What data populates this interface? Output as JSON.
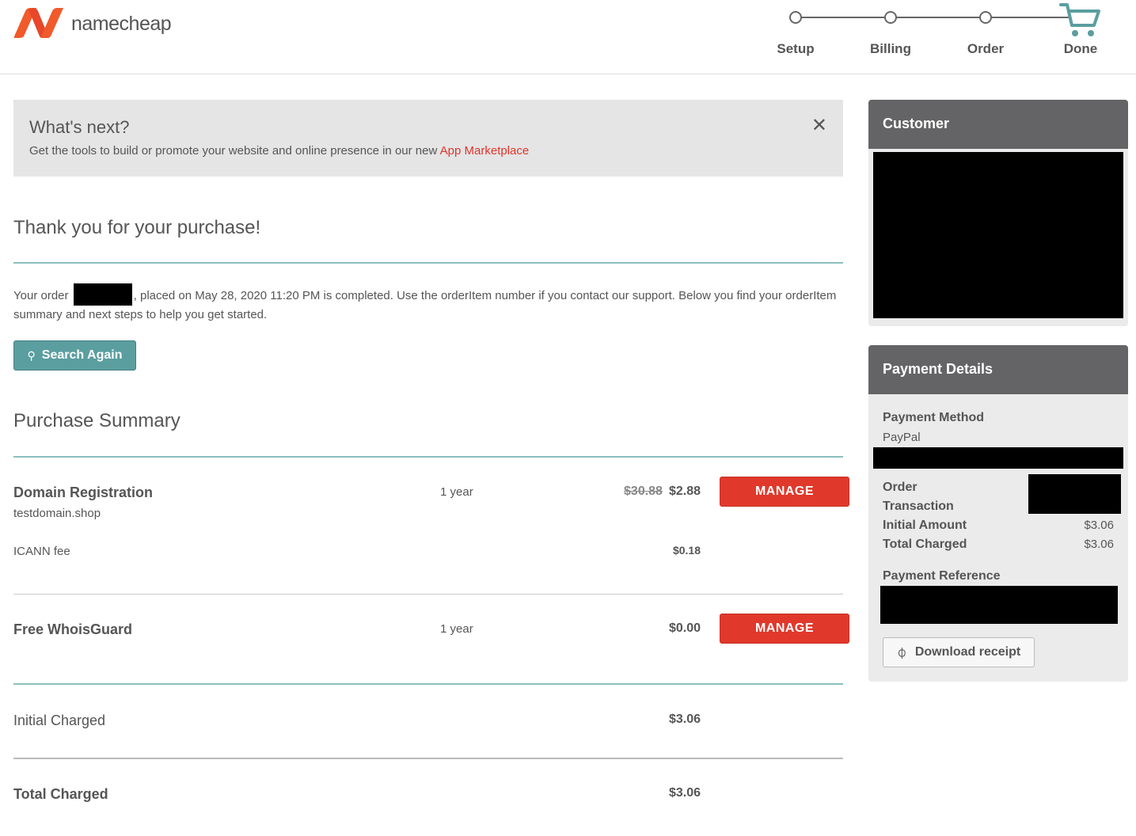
{
  "brand": {
    "name": "namecheap",
    "color": "#f15a2b"
  },
  "steps": [
    {
      "label": "Setup"
    },
    {
      "label": "Billing"
    },
    {
      "label": "Order"
    },
    {
      "label": "Done"
    }
  ],
  "notice": {
    "title": "What's next?",
    "text": "Get the tools to build or promote your website and online presence in our new ",
    "link": "App Marketplace",
    "close": "✕"
  },
  "thanks": {
    "heading": "Thank you for your purchase!",
    "order_prefix": "Your order ",
    "order_suffix": ", placed on May 28, 2020 11:20 PM is completed. Use the orderItem number if you contact our support. Below you find your orderItem summary and next steps to help you get started."
  },
  "search_again": {
    "label": "Search Again",
    "icon": "search-icon"
  },
  "summary": {
    "heading": "Purchase Summary",
    "items": [
      {
        "title": "Domain Registration",
        "subtitle": "testdomain.shop",
        "term": "1 year",
        "old_price": "$30.88",
        "price": "$2.88",
        "manage": "MANAGE",
        "fee_label": "ICANN fee",
        "fee_value": "$0.18"
      },
      {
        "title": "Free WhoisGuard",
        "term": "1 year",
        "price": "$0.00",
        "manage": "MANAGE"
      }
    ],
    "initial_label": "Initial Charged",
    "initial_value": "$3.06",
    "total_label": "Total Charged",
    "total_value": "$3.06"
  },
  "customer": {
    "heading": "Customer"
  },
  "payment": {
    "heading": "Payment Details",
    "method_label": "Payment Method",
    "method_value": "PayPal",
    "order_label": "Order",
    "transaction_label": "Transaction",
    "initial_label": "Initial Amount",
    "initial_value": "$3.06",
    "total_label": "Total Charged",
    "total_value": "$3.06",
    "reference_label": "Payment Reference",
    "download": "Download receipt"
  }
}
